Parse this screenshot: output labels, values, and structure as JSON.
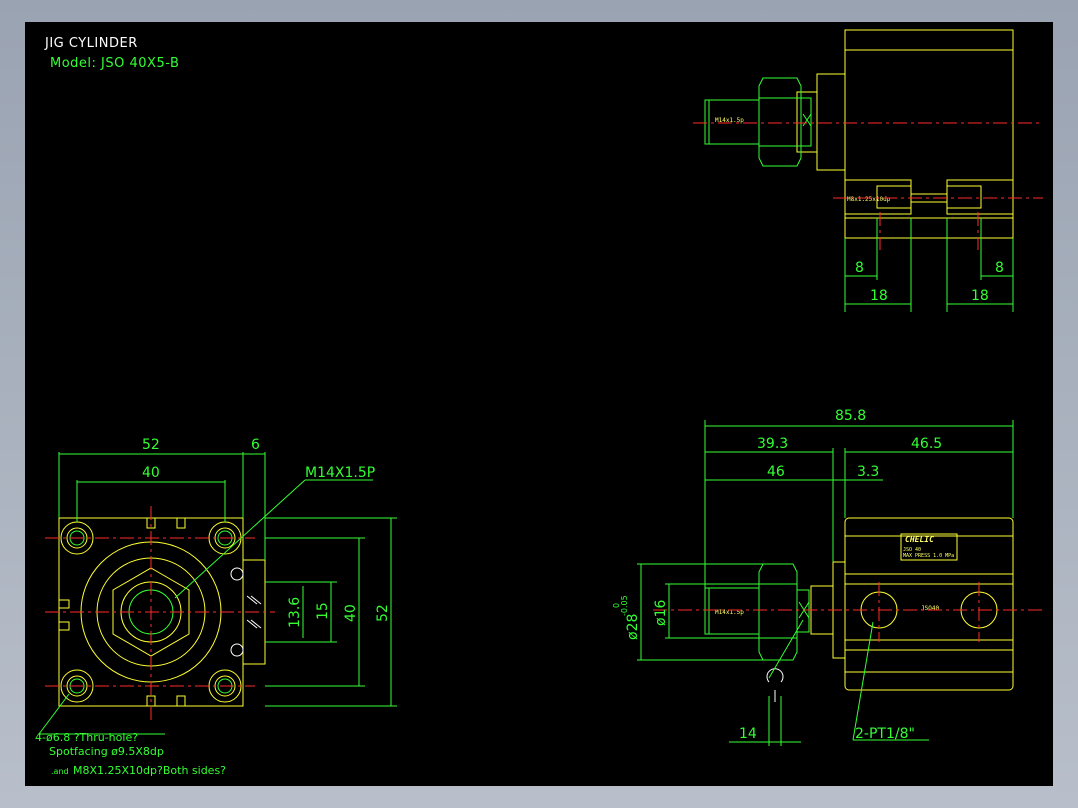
{
  "title": "JIG CYLINDER",
  "model": "Model:  JSO 40X5-B",
  "front_view": {
    "dim_width_outer": "52",
    "dim_width_inner": "40",
    "dim_offset": "6",
    "thread_label": "M14X1.5P",
    "dim_136": "13.6",
    "dim_15": "15",
    "dim_40_v": "40",
    "dim_52_v": "52",
    "note_line1": "4-ø6.8 ?Thru-hole?",
    "note_line2": "Spotfacing ø9.5X8dp",
    "note_line3a": ".and",
    "note_line3b": "M8X1.25X10dp?Both sides?"
  },
  "top_view": {
    "rod_thread": "M14x1.5p",
    "port_thread": "M8x1.25x10dp",
    "dim_8_left": "8",
    "dim_8_right": "8",
    "dim_18_left": "18",
    "dim_18_right": "18"
  },
  "side_view": {
    "dim_total": "85.8",
    "dim_393": "39.3",
    "dim_465": "46.5",
    "dim_46": "46",
    "dim_33": "3.3",
    "dim_dia28": "ø28",
    "tol_upper": "0",
    "tol_lower": "-0.05",
    "dim_dia16": "ø16",
    "rod_thread": "M14x1.5p",
    "dim_14": "14",
    "port_label": "2-PT1/8\"",
    "brand": "CHELIC",
    "plate_line1": "JSO 40",
    "plate_line2": "MAX PRESS  1.0 MPa",
    "body_mark": "JSO40"
  }
}
